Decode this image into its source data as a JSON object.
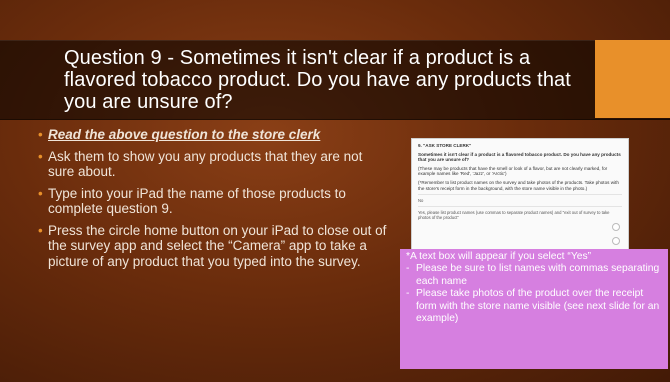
{
  "slide": {
    "title": "Question 9 - Sometimes it isn't clear if a product is a flavored tobacco product. Do you have any products that you are unsure of?",
    "accent_color": "#e8902a",
    "bullet_color": "#e8902a",
    "bullets": [
      {
        "text": "Read the above question to the store clerk",
        "emphasis": true
      },
      {
        "text": "Ask them to show you any products that they are not sure about.",
        "emphasis": false
      },
      {
        "text": "Type into your iPad the name of those products to complete question 9.",
        "emphasis": false
      },
      {
        "text": "Press the circle home button on your iPad to close out of the survey app and select the “Camera” app to take a picture of any product that you typed into the survey.",
        "emphasis": false
      }
    ],
    "screenshot": {
      "heading": "9. \"ASK STORE CLERK\"",
      "question": "Sometimes it isn't clear if a product is a flavored tobacco product. Do you have any products that you are unsure of?",
      "hint1": "(These may be products that have the smell or look of a flavor, but are not clearly marked, for example names like 'Red', 'Jazz', or 'Arctic')",
      "hint2": "(*Remember to list product names on the survey and take photos of the products. Take photos with the store's receipt form in the background, with the store name visible in the photo.)",
      "option_no": "No",
      "option_yes": "Yes, please list product names (use commas to separate product names) and \"exit out of survey to take photos of the product\""
    },
    "note": {
      "intro": "*A text box will appear if you select “Yes”",
      "items": [
        "Please be sure to list names with commas separating each name",
        "Please take photos of the product over the receipt form with the store name visible (see next slide for an example)"
      ],
      "bg_color": "#d67fe0"
    }
  }
}
